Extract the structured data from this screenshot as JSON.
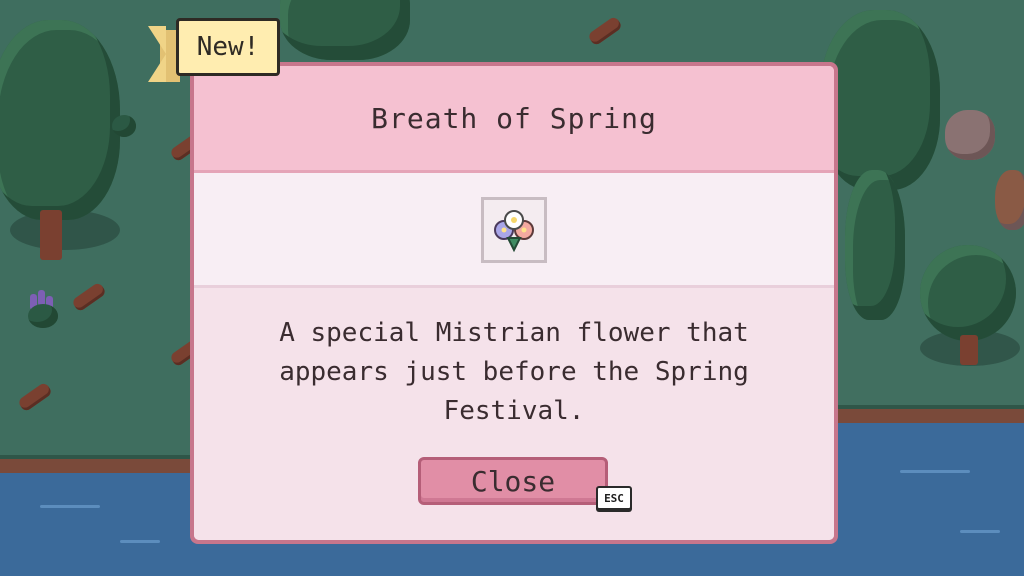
{
  "dialog": {
    "title": "Breath of Spring",
    "item_icon": "flower-bouquet-icon",
    "description": "A special Mistrian flower that appears just before the Spring Festival.",
    "close_label": "Close",
    "close_hotkey": "ESC"
  },
  "badge": {
    "label": "New!"
  },
  "colors": {
    "dialog_border": "#c7768c",
    "header_bg": "#f5c1d1",
    "body_bg": "#f7e9f1",
    "button_bg": "#e18ea6",
    "badge_bg": "#ffedb0"
  }
}
